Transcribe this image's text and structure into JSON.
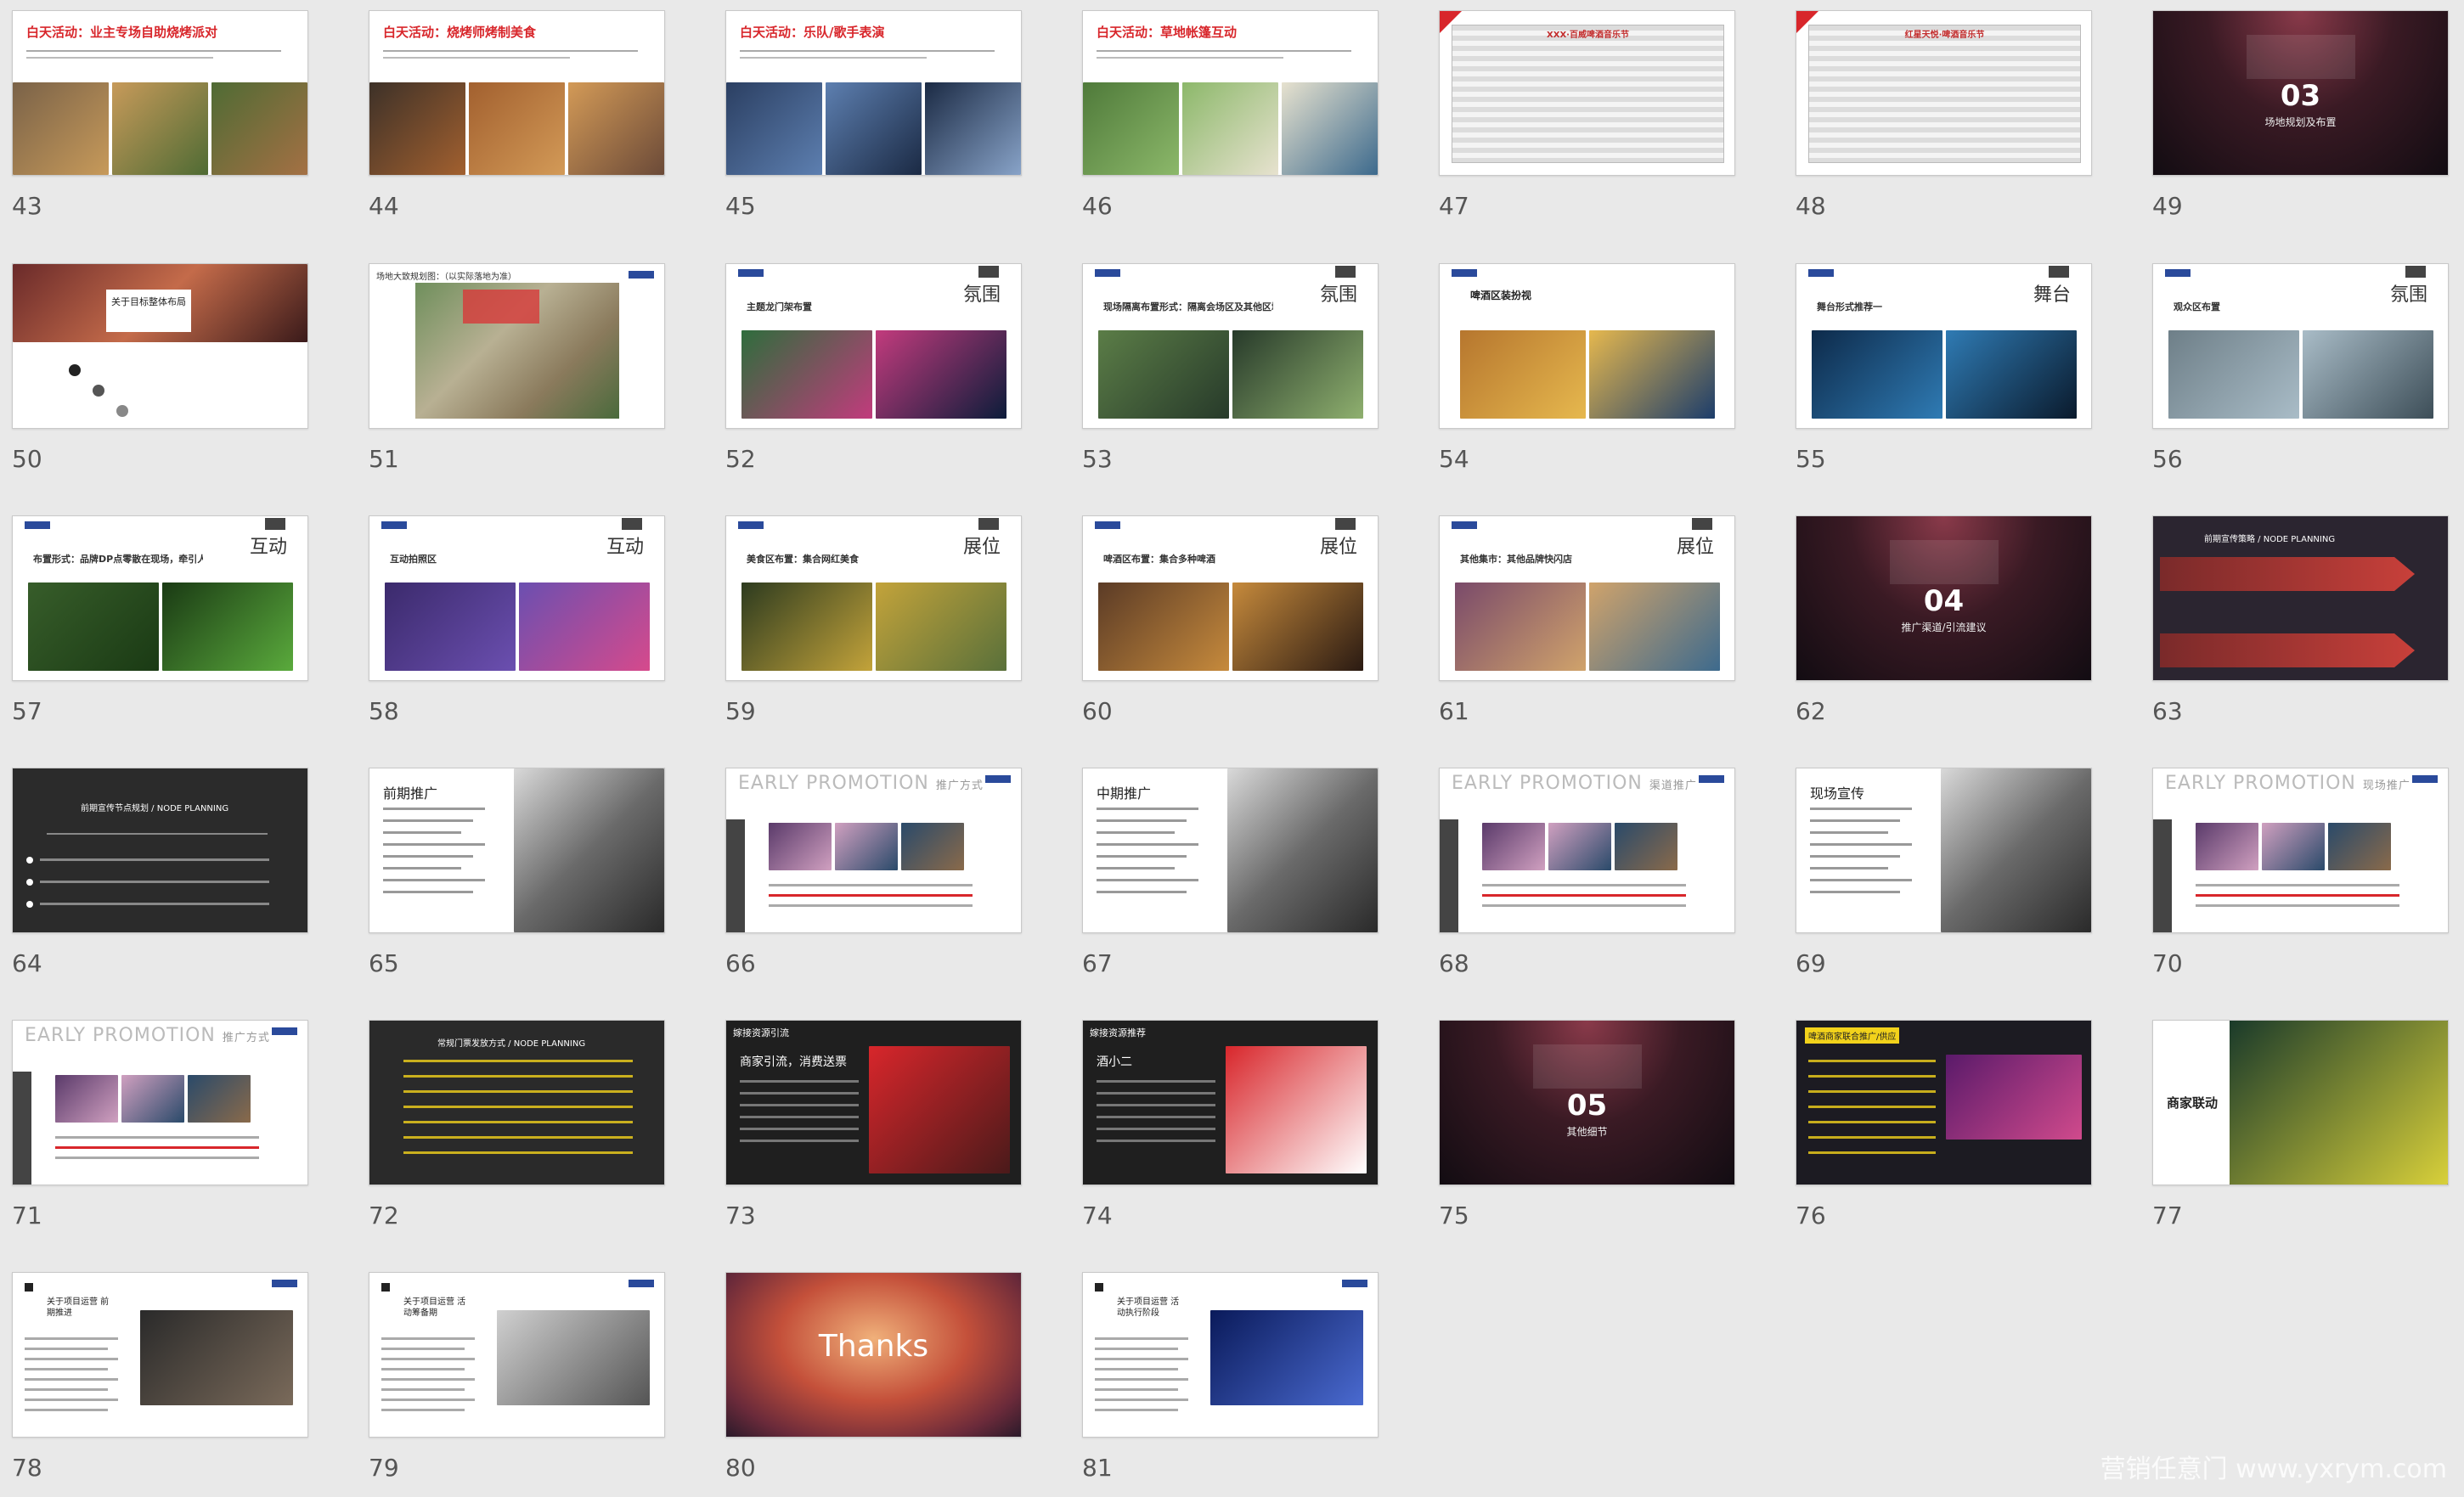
{
  "slides": [
    {
      "n": "43",
      "title": "白天活动：业主专场自助烧烤派对",
      "kind": "photo-title",
      "c": [
        "#7a6248",
        "#c79a5a",
        "#4f6b34",
        "#a47044"
      ]
    },
    {
      "n": "44",
      "title": "白天活动：烧烤师烤制美食",
      "kind": "photo-title",
      "c": [
        "#3d3128",
        "#a2602f",
        "#d39a57",
        "#6b4a38"
      ]
    },
    {
      "n": "45",
      "title": "白天活动：乐队/歌手表演",
      "kind": "photo-title",
      "c": [
        "#2b3f62",
        "#5d7fb0",
        "#1b2a44",
        "#88a3c8"
      ]
    },
    {
      "n": "46",
      "title": "白天活动：草地帐篷互动",
      "kind": "photo-title",
      "c": [
        "#4f7a3a",
        "#8cb86a",
        "#e7e2cf",
        "#3d6a8d"
      ]
    },
    {
      "n": "47",
      "title": "XXX·百威啤酒音乐节",
      "kind": "table"
    },
    {
      "n": "48",
      "title": "红星天悦·啤酒音乐节",
      "kind": "table"
    },
    {
      "n": "49",
      "title": "03",
      "sub": "场地规划及布置",
      "kind": "dark-big"
    },
    {
      "n": "50",
      "title": "关于目标整体布局",
      "kind": "split"
    },
    {
      "n": "51",
      "title": "场地大致规划图：（以实际落地为准）",
      "kind": "map"
    },
    {
      "n": "52",
      "title": "氛围",
      "sub": "主题龙门架布置",
      "kind": "cn-right",
      "c": [
        "#2e6d3c",
        "#c23b7d",
        "#0c1c3a",
        "#e1b32d"
      ]
    },
    {
      "n": "53",
      "title": "氛围",
      "sub": "现场隔离布置形式：隔离会场区及其他区域",
      "kind": "cn-right",
      "c": [
        "#5b7d47",
        "#273a2a",
        "#8fb06f",
        "#151a18"
      ]
    },
    {
      "n": "54",
      "title": "啤酒区装扮视",
      "sub": "",
      "kind": "cn-left",
      "c": [
        "#b6762e",
        "#e6b84e",
        "#1c3d6b",
        "#d9a64a"
      ]
    },
    {
      "n": "55",
      "title": "舞台",
      "sub": "舞台形式推荐一",
      "kind": "cn-right",
      "c": [
        "#0d2a4a",
        "#2f7bb4",
        "#0a1a2c",
        "#48c1d5"
      ]
    },
    {
      "n": "56",
      "title": "氛围",
      "sub": "观众区布置",
      "kind": "cn-right",
      "c": [
        "#6e7f88",
        "#a9bcc7",
        "#3d4e58",
        "#8a6a4b"
      ]
    },
    {
      "n": "57",
      "title": "互动",
      "sub": "布置形式：品牌DP点零散在现场，牵引人流。",
      "kind": "cn-right",
      "c": [
        "#375d2a",
        "#1a3a14",
        "#5aaa3c",
        "#9cc78a"
      ]
    },
    {
      "n": "58",
      "title": "互动",
      "sub": "互动拍照区",
      "kind": "cn-right",
      "c": [
        "#3b2a6c",
        "#6b4fb0",
        "#d64a8c",
        "#2a1a44"
      ]
    },
    {
      "n": "59",
      "title": "展位",
      "sub": "美食区布置：集合网红美食",
      "kind": "cn-right",
      "c": [
        "#2d3b1f",
        "#c3a33a",
        "#59703a",
        "#1a2212"
      ]
    },
    {
      "n": "60",
      "title": "展位",
      "sub": "啤酒区布置：集合多种啤酒",
      "kind": "cn-right",
      "c": [
        "#5b3b26",
        "#c68a3c",
        "#2a1a12",
        "#8a6a4a"
      ]
    },
    {
      "n": "61",
      "title": "展位",
      "sub": "其他集市：其他品牌快闪店",
      "kind": "cn-right",
      "c": [
        "#7a4a6a",
        "#d0a36b",
        "#3d6a8d",
        "#b34a4a"
      ]
    },
    {
      "n": "62",
      "title": "04",
      "sub": "推广渠道/引流建议",
      "kind": "dark-big"
    },
    {
      "n": "63",
      "title": "前期宣传策略 / NODE PLANNING",
      "kind": "arrows"
    },
    {
      "n": "64",
      "title": "前期宣传节点规划 / NODE PLANNING",
      "kind": "timeline"
    },
    {
      "n": "65",
      "title": "前期推广",
      "kind": "tablet"
    },
    {
      "n": "66",
      "title": "EARLY PROMOTION",
      "sub": "推广方式",
      "kind": "early"
    },
    {
      "n": "67",
      "title": "中期推广",
      "kind": "tablet"
    },
    {
      "n": "68",
      "title": "EARLY PROMOTION",
      "sub": "渠道推广",
      "kind": "early"
    },
    {
      "n": "69",
      "title": "现场宣传",
      "kind": "tablet"
    },
    {
      "n": "70",
      "title": "EARLY PROMOTION",
      "sub": "现场推广",
      "kind": "early"
    },
    {
      "n": "71",
      "title": "EARLY PROMOTION",
      "sub": "推广方式",
      "kind": "early"
    },
    {
      "n": "72",
      "title": "常规门票发放方式 / NODE PLANNING",
      "kind": "dark-list"
    },
    {
      "n": "73",
      "title": "商家引流，消费送票",
      "sub": "嫁接资源引流",
      "kind": "dark-text"
    },
    {
      "n": "74",
      "title": "酒小二",
      "sub": "嫁接资源推荐",
      "kind": "dark-text"
    },
    {
      "n": "75",
      "title": "05",
      "sub": "其他细节",
      "kind": "dark-big"
    },
    {
      "n": "76",
      "title": "啤酒商家联合推广/供应",
      "kind": "dark-list2"
    },
    {
      "n": "77",
      "title": "商家联动",
      "kind": "merchant"
    },
    {
      "n": "78",
      "title": "关于项目运营 前期推进",
      "kind": "about"
    },
    {
      "n": "79",
      "title": "关于项目运营 活动筹备期",
      "kind": "about"
    },
    {
      "n": "80",
      "title": "Thanks",
      "kind": "thanks"
    },
    {
      "n": "81",
      "title": "关于项目运营 活动执行阶段",
      "kind": "about"
    }
  ],
  "watermark": "营销任意门 www.yxrym.com"
}
